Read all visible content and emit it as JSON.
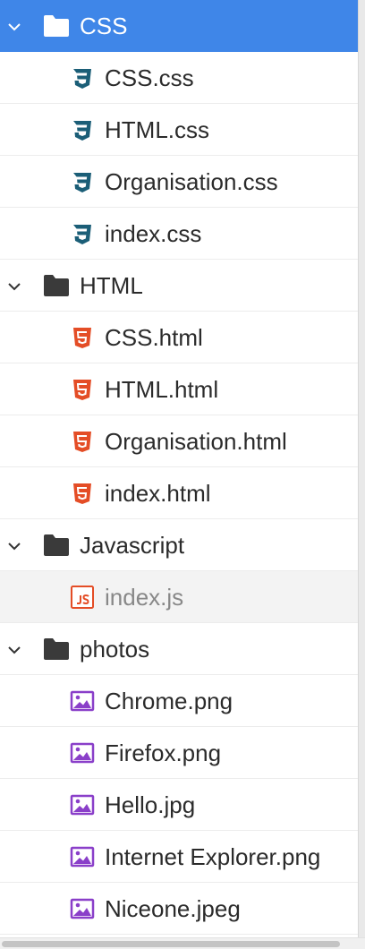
{
  "colors": {
    "selection": "#3f86e8",
    "folder": "#3a3a3a",
    "css_icon": "#1b5e77",
    "html_icon": "#e44d26",
    "js_icon": "#e44d26",
    "image_icon": "#8a3fc9"
  },
  "tree": [
    {
      "kind": "folder",
      "name": "CSS",
      "icon": "folder-icon",
      "expanded": true,
      "selected": true,
      "files": [
        {
          "name": "CSS.css",
          "icon": "css3-icon"
        },
        {
          "name": "HTML.css",
          "icon": "css3-icon"
        },
        {
          "name": "Organisation.css",
          "icon": "css3-icon"
        },
        {
          "name": "index.css",
          "icon": "css3-icon"
        }
      ]
    },
    {
      "kind": "folder",
      "name": "HTML",
      "icon": "folder-icon",
      "expanded": true,
      "files": [
        {
          "name": "CSS.html",
          "icon": "html5-icon"
        },
        {
          "name": "HTML.html",
          "icon": "html5-icon"
        },
        {
          "name": "Organisation.html",
          "icon": "html5-icon"
        },
        {
          "name": "index.html",
          "icon": "html5-icon"
        }
      ]
    },
    {
      "kind": "folder",
      "name": "Javascript",
      "icon": "folder-icon",
      "expanded": true,
      "files": [
        {
          "name": "index.js",
          "icon": "js-icon",
          "hover": true
        }
      ]
    },
    {
      "kind": "folder",
      "name": "photos",
      "icon": "folder-icon",
      "expanded": true,
      "files": [
        {
          "name": "Chrome.png",
          "icon": "image-icon"
        },
        {
          "name": "Firefox.png",
          "icon": "image-icon"
        },
        {
          "name": "Hello.jpg",
          "icon": "image-icon"
        },
        {
          "name": "Internet Explorer.png",
          "icon": "image-icon"
        },
        {
          "name": "Niceone.jpeg",
          "icon": "image-icon"
        }
      ]
    }
  ]
}
